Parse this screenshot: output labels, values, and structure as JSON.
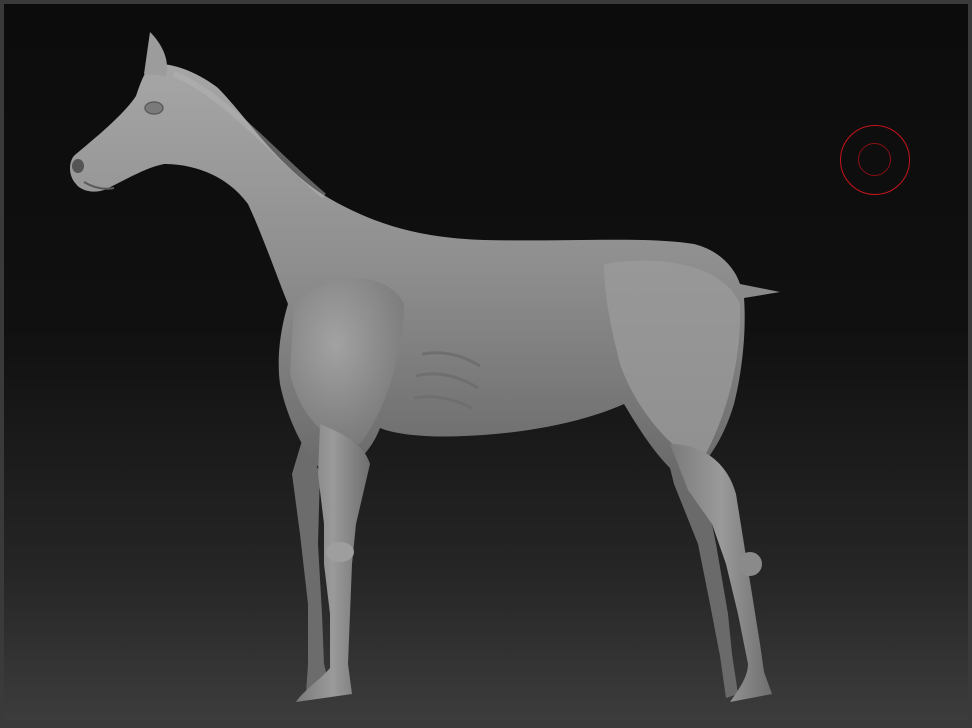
{
  "viewport": {
    "subject": "horse-sculpt-model",
    "background_top_color": "#0c0c0c",
    "background_bottom_color": "#3c3c3c",
    "model_color": "#8c8c8c"
  },
  "cursor": {
    "type": "brush-draw-size-cursor",
    "color": "#c8141c"
  }
}
